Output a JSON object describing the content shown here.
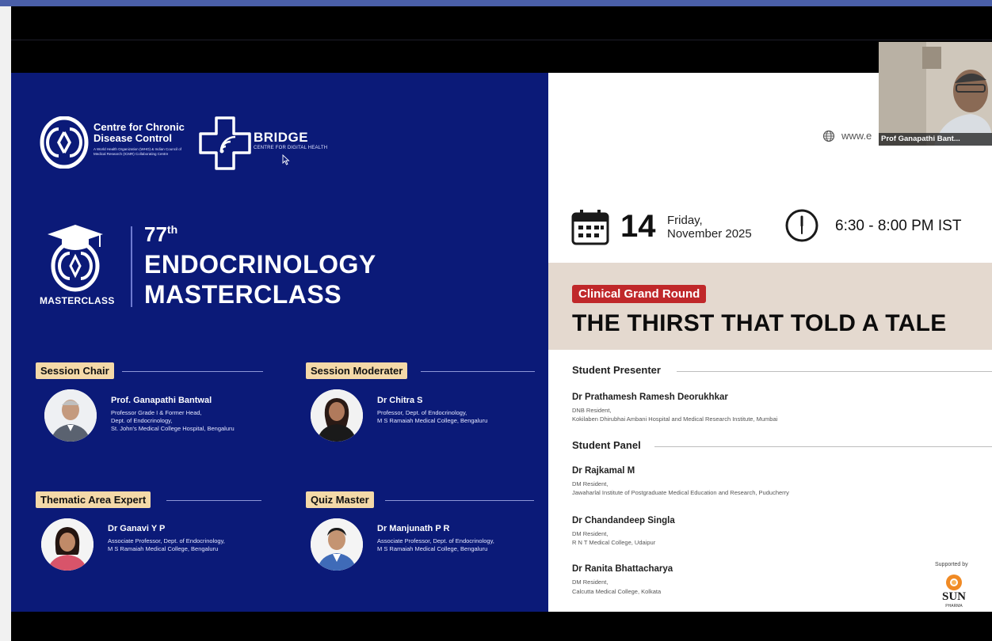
{
  "slide": {
    "org": {
      "ccdc_name": "Centre for Chronic Disease Control",
      "ccdc_sub": "A World Health Organization (WHO) & Indian Council of Medical Research (ICMR) Collaborating Centre",
      "bridge_name": "BRIDGE",
      "bridge_sub": "CENTRE FOR DIGITAL HEALTH"
    },
    "masterclass": {
      "logo_label": "MASTERCLASS",
      "number": "77",
      "suffix": "th",
      "title_line1": "ENDOCRINOLOGY",
      "title_line2": "MASTERCLASS"
    },
    "roles": [
      {
        "role": "Session Chair",
        "name": "Prof. Ganapathi Bantwal",
        "desc": [
          "Professor Grade I & Former Head,",
          "Dept. of Endocrinology,",
          "St. John's Medical College Hospital, Bengaluru"
        ]
      },
      {
        "role": "Session Moderater",
        "name": "Dr Chitra S",
        "desc": [
          "Professor, Dept. of Endocrinology,",
          "M S Ramaiah Medical College, Bengaluru"
        ]
      },
      {
        "role": "Thematic Area Expert",
        "name": "Dr Ganavi Y P",
        "desc": [
          "Associate Professor, Dept. of Endocrinology,",
          "M S Ramaiah Medical College, Bengaluru"
        ]
      },
      {
        "role": "Quiz Master",
        "name": "Dr Manjunath P R",
        "desc": [
          "Associate Professor, Dept. of Endocrinology,",
          "M S Ramaiah Medical College, Bengaluru"
        ]
      }
    ],
    "event": {
      "url": "www.e",
      "date_num": "14",
      "day": "Friday,",
      "month_year": "November 2025",
      "time": "6:30 - 8:00 PM IST",
      "tag": "Clinical Grand Round",
      "title": "THE THIRST THAT TOLD A TALE"
    },
    "presenter_section": "Student Presenter",
    "presenter": {
      "name": "Dr Prathamesh Ramesh Deorukhkar",
      "desc": [
        "DNB Resident,",
        "Kokilaben Dhirubhai Ambani Hospital and Medical Research Institute, Mumbai"
      ]
    },
    "panel_section": "Student Panel",
    "panel": [
      {
        "name": "Dr Rajkamal M",
        "desc": [
          "DM Resident,",
          "Jawaharlal Institute of Postgraduate Medical Education and Research, Puducherry"
        ]
      },
      {
        "name": "Dr Chandandeep Singla",
        "desc": [
          "DM Resident,",
          "R N T Medical College, Udaipur"
        ]
      },
      {
        "name": "Dr Ranita Bhattacharya",
        "desc": [
          "DM Resident,",
          "Calcutta Medical College, Kolkata"
        ]
      }
    ],
    "supported_by": "Supported by",
    "sponsor": "SUN",
    "sponsor_sub": "PHARMA"
  },
  "video": {
    "participant_label": "Prof Ganapathi Bant..."
  },
  "colors": {
    "panel_blue": "#0b1a78",
    "tag_beige": "#f4d9a8",
    "band_beige": "#e4d9cf",
    "clinical_red": "#c0282a",
    "top_bar": "#4a5fa8"
  }
}
